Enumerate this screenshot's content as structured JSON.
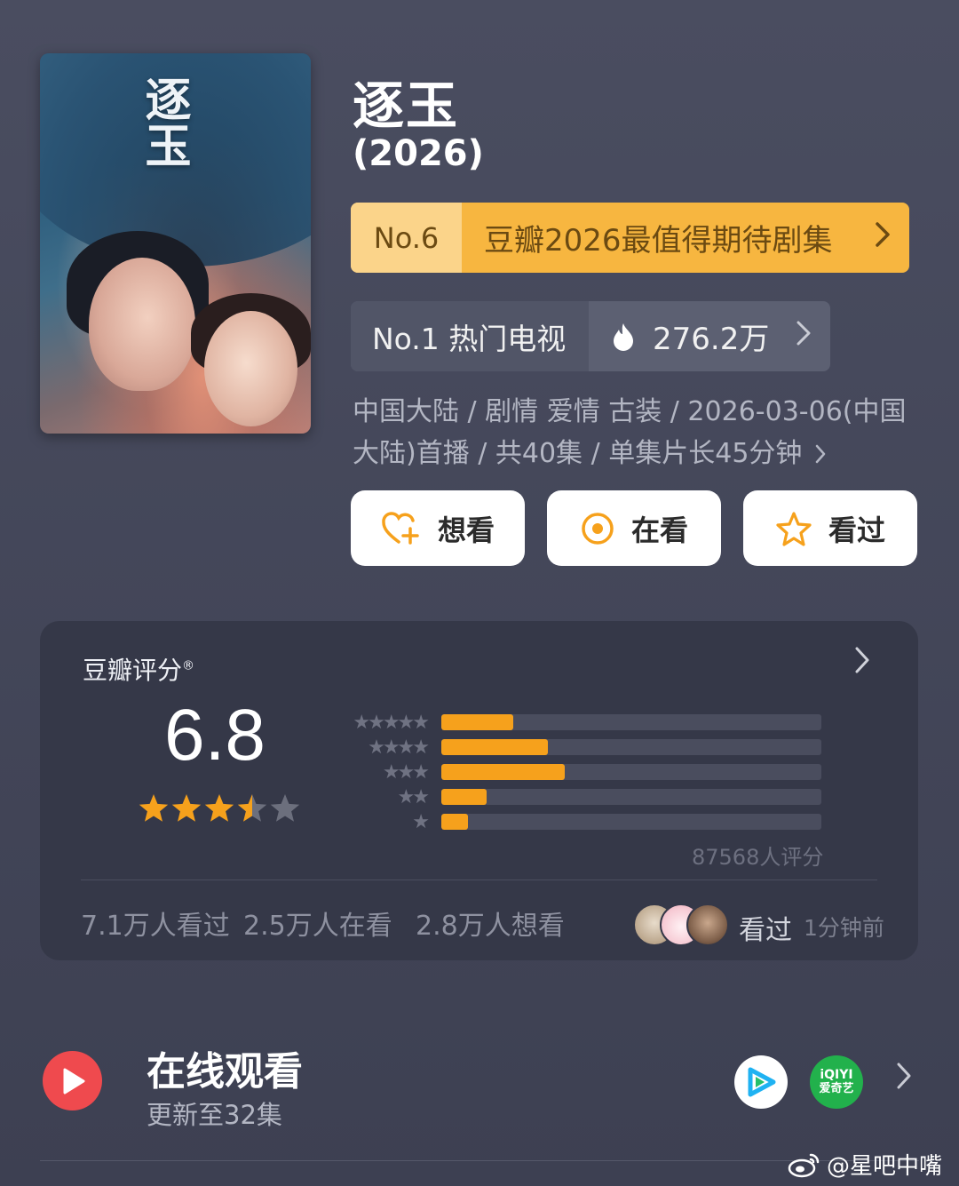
{
  "poster": {
    "title": "逐玉"
  },
  "title": "逐玉",
  "year": "(2026)",
  "rank_orange": {
    "no": "No.6",
    "label": "豆瓣2026最值得期待剧集"
  },
  "rank_grey": {
    "label": "No.1 热门电视",
    "heat": "276.2万"
  },
  "info": {
    "line1": "中国大陆 / 剧情 爱情 古装 / 2026-03-06(中国",
    "line2": "大陆)首播 / 共40集 / 单集片长45分钟"
  },
  "actions": {
    "want": "想看",
    "watching": "在看",
    "watched": "看过"
  },
  "rating": {
    "label": "豆瓣评分",
    "registered": "®",
    "score": "6.8",
    "stars_value": 3.5,
    "count": "87568人评分",
    "distribution": [
      {
        "stars": 5,
        "fraction": 0.19
      },
      {
        "stars": 4,
        "fraction": 0.28
      },
      {
        "stars": 3,
        "fraction": 0.325
      },
      {
        "stars": 2,
        "fraction": 0.12
      },
      {
        "stars": 1,
        "fraction": 0.07
      }
    ],
    "watched": "7.1万人看过",
    "watching": "2.5万人在看",
    "want": "2.8万人想看",
    "seen_label": "看过",
    "seen_ago": "1分钟前"
  },
  "online": {
    "title": "在线观看",
    "subtitle": "更新至32集",
    "iqiyi_logo": "iQIYI",
    "iqiyi_cn": "爱奇艺"
  },
  "watermark": "@星吧中嘴",
  "colors": {
    "accent": "#f6a11c",
    "rank_orange": "#f7b640",
    "play_red": "#ef4a4e",
    "iqiyi_green": "#22b14c"
  }
}
